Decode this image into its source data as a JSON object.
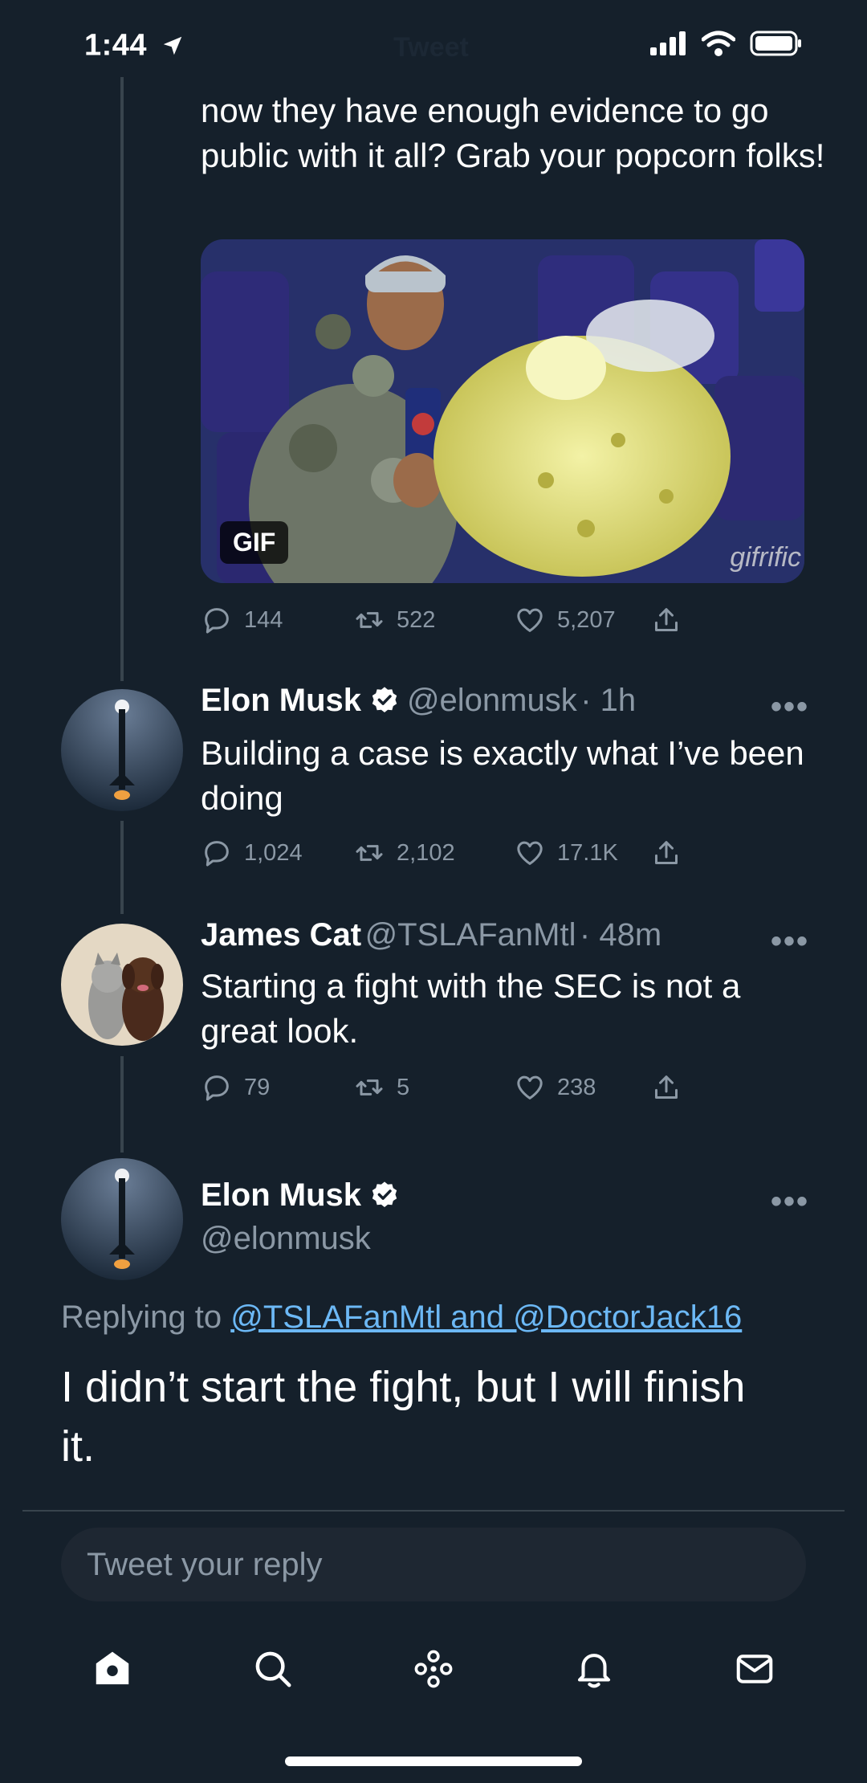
{
  "status_bar": {
    "time": "1:44"
  },
  "header": {
    "title": "Tweet"
  },
  "quoted_tweet": {
    "text": "now they have enough evidence to go public with it all? Grab your popcorn folks!",
    "media": {
      "badge": "GIF",
      "watermark": "gifrific"
    },
    "stats": {
      "replies": "144",
      "retweets": "522",
      "likes": "5,207"
    }
  },
  "reply1": {
    "name": "Elon Musk",
    "handle": "@elonmusk",
    "time": "· 1h",
    "text": "Building a case is exactly what I’ve been doing",
    "stats": {
      "replies": "1,024",
      "retweets": "2,102",
      "likes": "17.1K"
    }
  },
  "reply2": {
    "name": "James Cat",
    "handle": "@TSLAFanMtl",
    "time": "· 48m",
    "text": "Starting a fight with the SEC is not a great look.",
    "stats": {
      "replies": "79",
      "retweets": "5",
      "likes": "238"
    }
  },
  "main_tweet": {
    "name": "Elon Musk",
    "handle": "@elonmusk",
    "replying_prefix": "Replying to",
    "replying_to": "@TSLAFanMtl and @DoctorJack16",
    "text": "I didn’t start the fight, but I will finish it."
  },
  "composer": {
    "placeholder": "Tweet your reply"
  },
  "tab_bar": {
    "items": [
      "home-icon",
      "search-icon",
      "spaces-icon",
      "notifications-icon",
      "messages-icon"
    ]
  },
  "colors": {
    "background": "#15202b",
    "accent": "#1d9bf0",
    "muted": "#8b98a5",
    "link": "#6cb8f5"
  }
}
